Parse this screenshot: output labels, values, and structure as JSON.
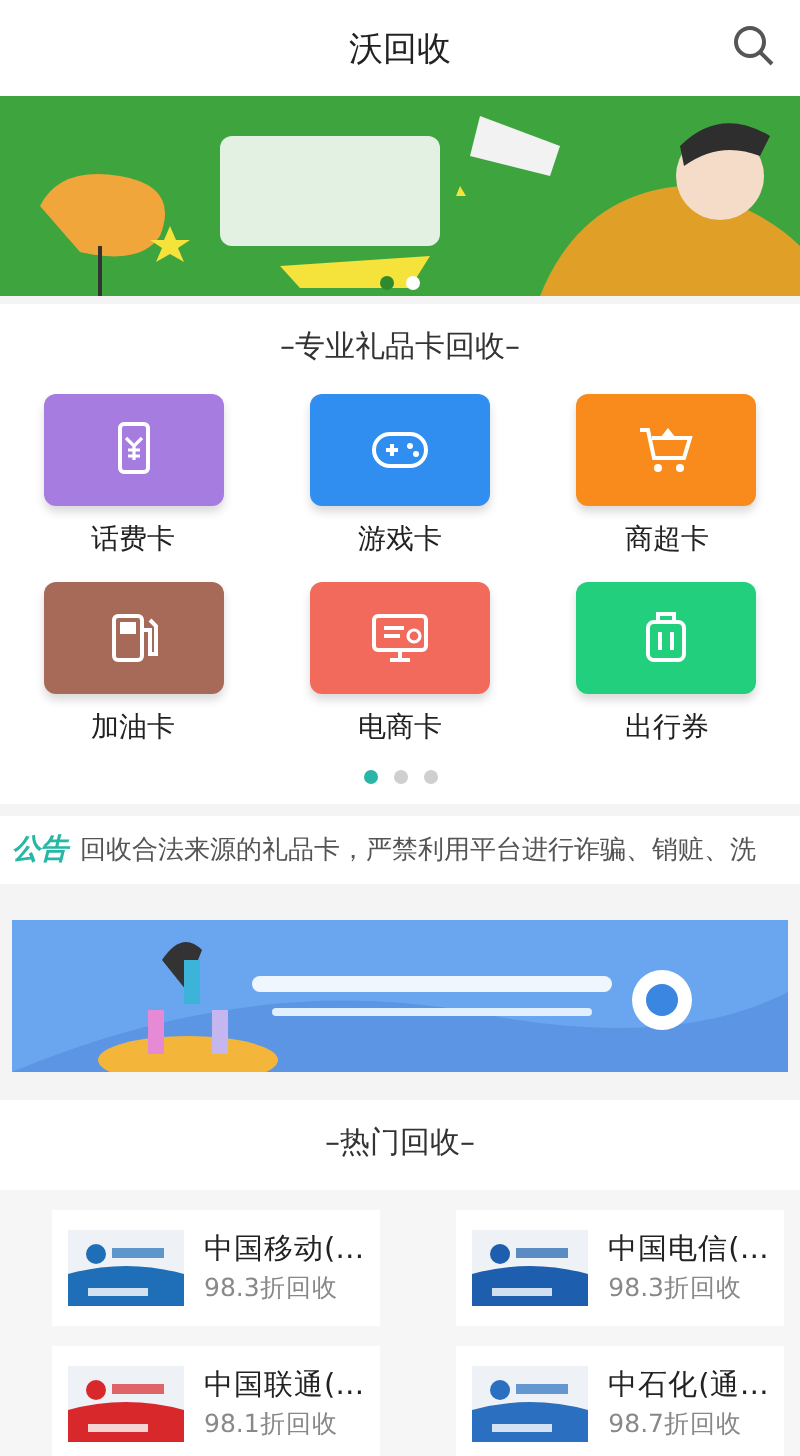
{
  "header": {
    "title": "沃回收"
  },
  "banner": {
    "dots": [
      {
        "selected": false
      },
      {
        "selected": true
      }
    ]
  },
  "categories": {
    "title": "–专业礼品卡回收–",
    "items": [
      {
        "label": "话费卡",
        "color": "#a77ce0"
      },
      {
        "label": "游戏卡",
        "color": "#2f8ef0"
      },
      {
        "label": "商超卡",
        "color": "#f98b1c"
      },
      {
        "label": "加油卡",
        "color": "#a86a58"
      },
      {
        "label": "电商卡",
        "color": "#f26a5c"
      },
      {
        "label": "出行券",
        "color": "#21cf7c"
      }
    ],
    "dots": [
      {
        "selected": true
      },
      {
        "selected": false
      },
      {
        "selected": false
      }
    ]
  },
  "notice": {
    "badge": "公告",
    "text": "回收合法来源的礼品卡，严禁利用平台进行诈骗、销赃、洗"
  },
  "hot": {
    "title": "–热门回收–",
    "items": [
      {
        "name": "中国移动(…",
        "rate": "98.3折回收"
      },
      {
        "name": "中国电信(…",
        "rate": "98.3折回收"
      },
      {
        "name": "中国联通(…",
        "rate": "98.1折回收"
      },
      {
        "name": "中石化(通…",
        "rate": "98.7折回收"
      }
    ]
  }
}
